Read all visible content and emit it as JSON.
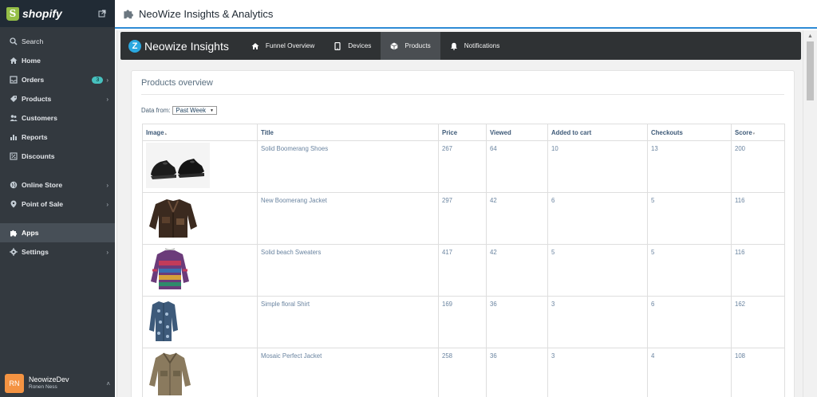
{
  "sidebar": {
    "logo_letter": "S",
    "logo_text": "shopify",
    "items": [
      {
        "label": "Search",
        "icon": "search-icon"
      },
      {
        "label": "Home",
        "icon": "home-icon"
      },
      {
        "label": "Orders",
        "icon": "orders-icon",
        "badge": "3"
      },
      {
        "label": "Products",
        "icon": "tag-icon"
      },
      {
        "label": "Customers",
        "icon": "customers-icon"
      },
      {
        "label": "Reports",
        "icon": "reports-icon"
      },
      {
        "label": "Discounts",
        "icon": "discounts-icon"
      },
      {
        "label": "Online Store",
        "icon": "globe-icon"
      },
      {
        "label": "Point of Sale",
        "icon": "location-icon"
      },
      {
        "label": "Apps",
        "icon": "puzzle-icon"
      },
      {
        "label": "Settings",
        "icon": "gear-icon"
      }
    ],
    "user": {
      "initials": "RN",
      "store": "NeowizeDev",
      "name": "Ronen Ness"
    }
  },
  "app_header": {
    "title": "NeoWize Insights & Analytics"
  },
  "app": {
    "brand_letter": "Z",
    "brand_name": "Neowize Insights",
    "tabs": [
      {
        "label": "Funnel Overview",
        "icon": "home-icon"
      },
      {
        "label": "Devices",
        "icon": "device-icon"
      },
      {
        "label": "Products",
        "icon": "cube-icon"
      },
      {
        "label": "Notifications",
        "icon": "bell-icon"
      }
    ],
    "active_tab": "Products",
    "panel": {
      "title": "Products overview",
      "filter_label": "Data from:",
      "filter_value": "Past Week",
      "columns": [
        "Image",
        "Title",
        "Price",
        "Viewed",
        "Added to cart",
        "Checkouts",
        "Score"
      ],
      "sortable_columns": [
        "Image",
        "Score"
      ],
      "rows": [
        {
          "image": "shoes",
          "title": "Solid Boomerang Shoes",
          "price": "267",
          "viewed": "64",
          "added": "10",
          "checkouts": "13",
          "score": "200"
        },
        {
          "image": "leather-jacket",
          "title": "New Boomerang Jacket",
          "price": "297",
          "viewed": "42",
          "added": "6",
          "checkouts": "5",
          "score": "116"
        },
        {
          "image": "sweater",
          "title": "Solid beach Sweaters",
          "price": "417",
          "viewed": "42",
          "added": "5",
          "checkouts": "5",
          "score": "116"
        },
        {
          "image": "shirt",
          "title": "Simple floral Shirt",
          "price": "169",
          "viewed": "36",
          "added": "3",
          "checkouts": "6",
          "score": "162"
        },
        {
          "image": "field-jacket",
          "title": "Mosaic Perfect Jacket",
          "price": "258",
          "viewed": "36",
          "added": "3",
          "checkouts": "4",
          "score": "108"
        }
      ]
    }
  },
  "colors": {
    "sidebar": "#33393f",
    "sidebar_top": "#212b35",
    "accent": "#2e8bd5",
    "navbar": "#2f3234",
    "badge": "#47c1bf"
  }
}
